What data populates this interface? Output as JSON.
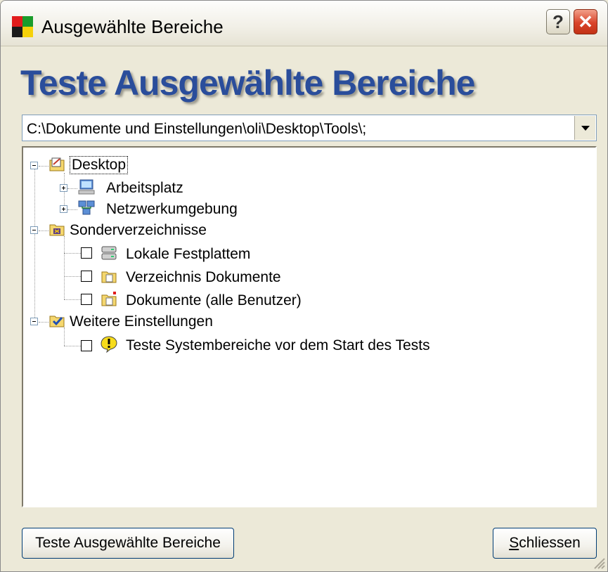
{
  "window": {
    "title": "Ausgewählte Bereiche",
    "help_label": "?",
    "close_label": "✕"
  },
  "heading": "Teste Ausgewählte Bereiche",
  "path": {
    "value": "C:\\Dokumente und Einstellungen\\oli\\Desktop\\Tools\\;"
  },
  "tree": {
    "desktop": {
      "label": "Desktop",
      "icon": "desktop-folder-icon"
    },
    "arbeitsplatz": {
      "label": "Arbeitsplatz",
      "icon": "computer-icon"
    },
    "netzwerk": {
      "label": "Netzwerkumgebung",
      "icon": "network-icon"
    },
    "sonder": {
      "label": "Sonderverzeichnisse",
      "icon": "special-folder-icon"
    },
    "lokale": {
      "label": "Lokale Festplattem",
      "icon": "hard-drive-icon",
      "checked": false
    },
    "verzeichnis": {
      "label": "Verzeichnis Dokumente",
      "icon": "folder-icon",
      "checked": false
    },
    "dokumente_alle": {
      "label": "Dokumente (alle Benutzer)",
      "icon": "shared-folder-icon",
      "checked": false
    },
    "weitere": {
      "label": "Weitere Einstellungen",
      "icon": "checked-folder-icon"
    },
    "teste_system": {
      "label": "Teste Systembereiche vor dem Start des Tests",
      "icon": "warning-icon",
      "checked": false
    }
  },
  "buttons": {
    "test_label": "Teste Ausgewählte Bereiche",
    "close_label": "Schliessen"
  },
  "colors": {
    "heading": "#2a4d9b",
    "window_bg": "#ece9d8",
    "close_red": "#d9442a"
  }
}
